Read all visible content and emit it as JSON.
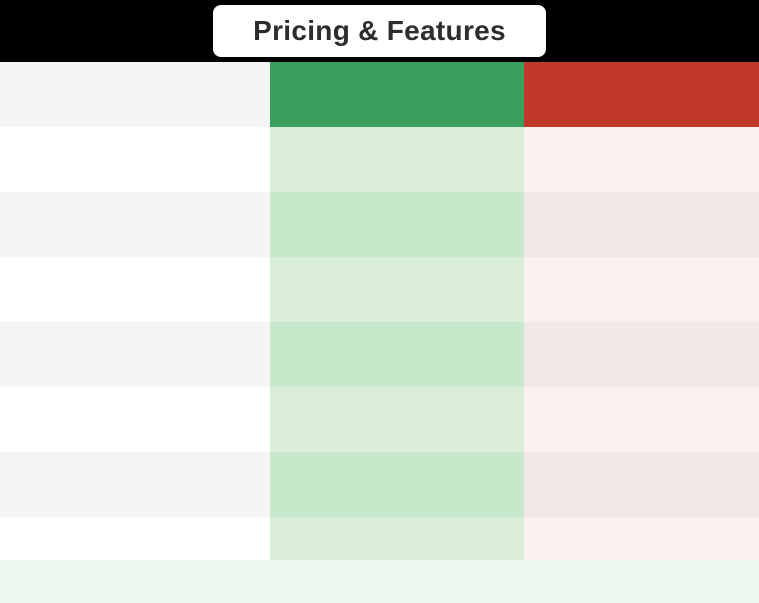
{
  "header": {
    "title": "Pricing & Features"
  },
  "columns": {
    "left": {
      "label": ""
    },
    "middle": {
      "label": "",
      "bg_header": "#3a9e5c"
    },
    "right": {
      "label": "",
      "bg_header": "#c0392b"
    }
  },
  "rows": [
    {
      "id": 1,
      "odd": true
    },
    {
      "id": 2,
      "odd": false
    },
    {
      "id": 3,
      "odd": true
    },
    {
      "id": 4,
      "odd": false
    },
    {
      "id": 5,
      "odd": true
    },
    {
      "id": 6,
      "odd": false
    },
    {
      "id": 7,
      "odd": true
    },
    {
      "id": 8,
      "special": true
    }
  ],
  "colors": {
    "black": "#000000",
    "white": "#ffffff",
    "title_bg": "#ffffff",
    "left_odd": "#ffffff",
    "left_even": "#f5f5f5",
    "mid_odd": "#d4edd9",
    "mid_even": "#c5e6cc",
    "right_odd": "#f9f0f0",
    "right_even": "#f2e6e6",
    "header_left": "#f5f5f5",
    "header_mid": "#3a9e5c",
    "header_right": "#c0392b",
    "last_row": "#edf7ed"
  }
}
